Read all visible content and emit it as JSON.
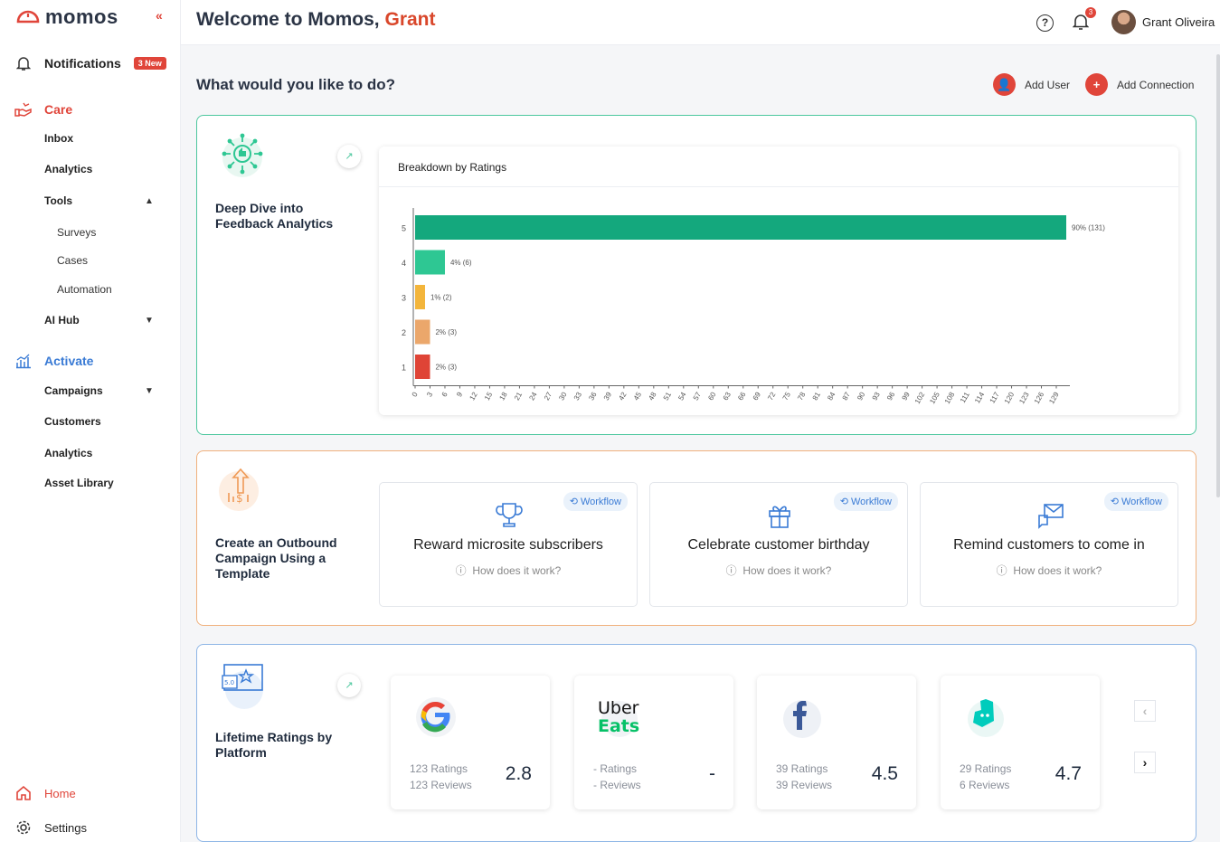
{
  "brand": {
    "name": "momos"
  },
  "sidebar": {
    "notifications": {
      "label": "Notifications",
      "badge": "3 New"
    },
    "care": {
      "label": "Care",
      "items": [
        "Inbox",
        "Analytics"
      ],
      "tools": {
        "label": "Tools",
        "items": [
          "Surveys",
          "Cases",
          "Automation"
        ]
      },
      "ai_hub": "AI Hub"
    },
    "activate": {
      "label": "Activate",
      "campaigns": "Campaigns",
      "customers": "Customers",
      "analytics": "Analytics",
      "asset_library": "Asset Library"
    },
    "home": "Home",
    "settings": "Settings"
  },
  "header": {
    "welcome": "Welcome to Momos,",
    "name": "Grant",
    "notification_count": "3",
    "user": "Grant Oliveira"
  },
  "main": {
    "question": "What would you like to do?",
    "actions": {
      "add_user": "Add User",
      "add_connection": "Add Connection"
    },
    "feedback": {
      "title": "Deep Dive into Feedback Analytics"
    },
    "outbound": {
      "title": "Create an Outbound Campaign Using a Template"
    },
    "workflows": [
      {
        "tag": "Workflow",
        "title": "Reward microsite subscribers",
        "how": "How does it work?"
      },
      {
        "tag": "Workflow",
        "title": "Celebrate customer birthday",
        "how": "How does it work?"
      },
      {
        "tag": "Workflow",
        "title": "Remind customers to come in",
        "how": "How does it work?"
      }
    ],
    "ratings": {
      "title": "Lifetime Ratings by Platform"
    },
    "platforms": [
      {
        "name": "Google",
        "ratings": "123 Ratings",
        "reviews": "123 Reviews",
        "score": "2.8"
      },
      {
        "name": "Uber Eats",
        "ratings": "- Ratings",
        "reviews": "- Reviews",
        "score": "-"
      },
      {
        "name": "Facebook",
        "ratings": "39 Ratings",
        "reviews": "39 Reviews",
        "score": "4.5"
      },
      {
        "name": "Deliveroo",
        "ratings": "29 Ratings",
        "reviews": "6 Reviews",
        "score": "4.7"
      }
    ]
  },
  "chart_data": {
    "type": "bar",
    "title": "Breakdown by Ratings",
    "categories": [
      "5",
      "4",
      "3",
      "2",
      "1"
    ],
    "values": [
      131,
      6,
      2,
      3,
      3
    ],
    "labels": [
      "90% (131)",
      "4% (6)",
      "1% (2)",
      "2% (3)",
      "2% (3)"
    ],
    "colors": [
      "#14a87d",
      "#2ec793",
      "#f3b53b",
      "#eba76b",
      "#df4436"
    ],
    "xlim": [
      0,
      131
    ],
    "xticks": [
      0,
      3,
      6,
      9,
      12,
      15,
      18,
      21,
      24,
      27,
      30,
      33,
      36,
      39,
      42,
      45,
      48,
      51,
      54,
      57,
      60,
      63,
      66,
      69,
      72,
      75,
      78,
      81,
      84,
      87,
      90,
      93,
      96,
      99,
      102,
      105,
      108,
      111,
      114,
      117,
      120,
      123,
      126,
      129
    ],
    "orientation": "horizontal"
  }
}
